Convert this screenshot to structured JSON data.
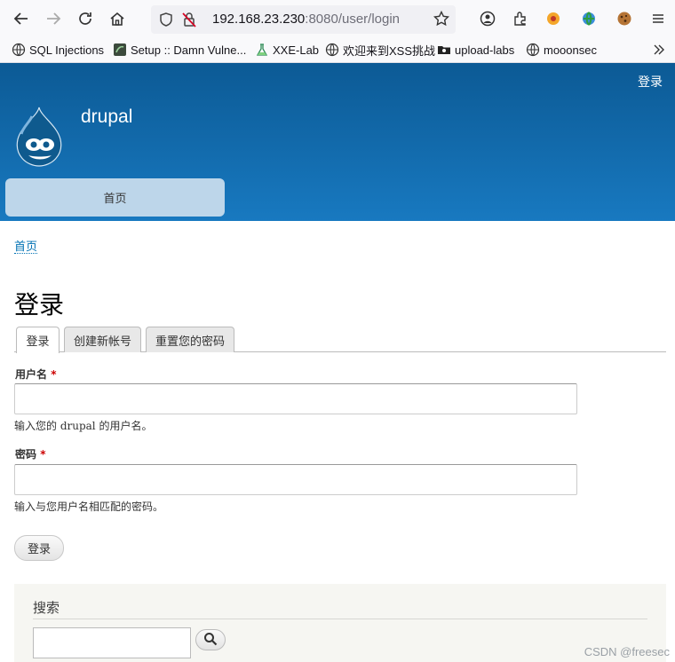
{
  "browser": {
    "url_host": "192.168.23.230",
    "url_rest": ":8080/user/login",
    "bookmarks": [
      {
        "label": "SQL Injections",
        "icon": "globe-icon"
      },
      {
        "label": "Setup :: Damn Vulne...",
        "icon": "dvwa-icon"
      },
      {
        "label": "XXE-Lab",
        "icon": "flask-icon"
      },
      {
        "label": "欢迎来到XSS挑战",
        "icon": "globe-icon"
      },
      {
        "label": "upload-labs",
        "icon": "folder-icon"
      },
      {
        "label": "mooonsec",
        "icon": "globe-icon"
      }
    ]
  },
  "header": {
    "login_link": "登录",
    "site_name": "drupal",
    "nav_home": "首页",
    "brand_color": "#1879c0"
  },
  "content": {
    "breadcrumb": "首页",
    "title": "登录",
    "tabs": [
      "登录",
      "创建新帐号",
      "重置您的密码"
    ],
    "username_label": "用户名",
    "required_mark": "*",
    "username_desc": "输入您的 drupal 的用户名。",
    "password_label": "密码",
    "password_desc": "输入与您用户名相匹配的密码。",
    "submit_label": "登录"
  },
  "search": {
    "title": "搜索"
  },
  "watermark": "CSDN @freesec"
}
